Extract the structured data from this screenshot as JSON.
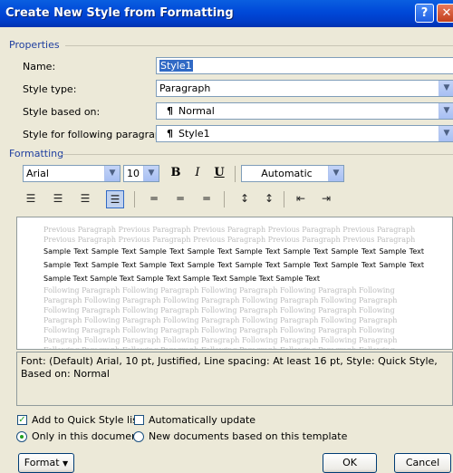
{
  "window": {
    "title": "Create New Style from Formatting",
    "help_glyph": "?",
    "close_glyph": "✕"
  },
  "properties": {
    "heading": "Properties",
    "name_label": "Name:",
    "name_value": "Style1",
    "style_type_label": "Style type:",
    "style_type_value": "Paragraph",
    "based_on_label": "Style based on:",
    "based_on_value": "Normal",
    "following_label": "Style for following paragraph:",
    "following_value": "Style1"
  },
  "formatting": {
    "heading": "Formatting",
    "font": "Arial",
    "size": "10",
    "bold": "B",
    "italic": "I",
    "underline": "U",
    "color": "Automatic"
  },
  "preview": {
    "previous_text": "Previous Paragraph Previous Paragraph Previous Paragraph Previous Paragraph Previous Paragraph Previous Paragraph Previous Paragraph Previous Paragraph Previous Paragraph Previous Paragraph",
    "sample_text": "Sample Text Sample Text Sample Text Sample Text Sample Text Sample Text Sample Text Sample Text Sample Text Sample Text Sample Text Sample Text Sample Text Sample Text Sample Text Sample Text Sample Text Sample Text Sample Text Sample Text Sample Text Sample Text",
    "following_text": "Following Paragraph Following Paragraph Following Paragraph Following Paragraph Following Paragraph Following Paragraph Following Paragraph Following Paragraph Following Paragraph Following Paragraph Following Paragraph Following Paragraph Following Paragraph Following Paragraph Following Paragraph Following Paragraph Following Paragraph Following Paragraph Following Paragraph Following Paragraph Following Paragraph Following Paragraph Following Paragraph Following Paragraph Following Paragraph Following Paragraph Following Paragraph Following Paragraph Following Paragraph Following Paragraph Following Paragraph Following Paragraph Following Paragraph Following Paragraph Following Paragraph Following Paragraph"
  },
  "description": "Font: (Default) Arial, 10 pt, Justified, Line spacing:  At least 16 pt, Style: Quick Style, Based on: Normal",
  "options": {
    "add_quick_style": "Add to Quick Style list",
    "auto_update": "Automatically update",
    "only_this_doc": "Only in this document",
    "new_docs": "New documents based on this template"
  },
  "buttons": {
    "format": "Format",
    "ok": "OK",
    "cancel": "Cancel"
  },
  "colors": {
    "title_bar": "#0048d8",
    "dialog_bg": "#ece9d8",
    "section_heading": "#1f3f9f",
    "selection": "#316ac5"
  }
}
